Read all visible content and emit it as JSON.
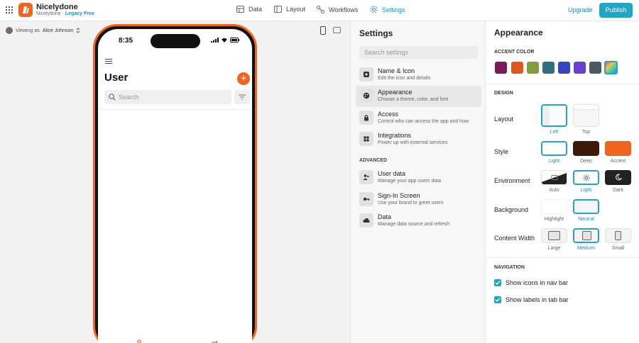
{
  "app": {
    "name": "Nicelydone",
    "org": "Nicelydone",
    "separator": "·",
    "plan": "Legacy Free"
  },
  "nav": {
    "data": "Data",
    "layout": "Layout",
    "workflows": "Workflows",
    "settings": "Settings"
  },
  "actions": {
    "upgrade": "Upgrade",
    "publish": "Publish"
  },
  "canvas": {
    "viewing_prefix": "Viewing as",
    "viewing_user": "Alice Johnson"
  },
  "phone": {
    "time": "8:35",
    "screen_title": "User",
    "add_symbol": "+",
    "search_placeholder": "Search"
  },
  "settings": {
    "title": "Settings",
    "search_placeholder": "Search settings",
    "items": [
      {
        "title": "Name & Icon",
        "desc": "Edit the icon and details",
        "icon": "app-icon"
      },
      {
        "title": "Appearance",
        "desc": "Choose a theme, color, and font",
        "icon": "palette-icon"
      },
      {
        "title": "Access",
        "desc": "Control who can access the app and how",
        "icon": "lock-icon"
      },
      {
        "title": "Integrations",
        "desc": "Power up with external services",
        "icon": "puzzle-icon"
      }
    ],
    "advanced_label": "ADVANCED",
    "advanced": [
      {
        "title": "User data",
        "desc": "Manage your app users data",
        "icon": "users-icon"
      },
      {
        "title": "Sign-In Screen",
        "desc": "Use your brand to greet users",
        "icon": "key-icon"
      },
      {
        "title": "Data",
        "desc": "Manage data source and refresh",
        "icon": "cloud-icon"
      }
    ]
  },
  "appearance": {
    "title": "Appearance",
    "accent_label": "ACCENT COLOR",
    "accent_colors": [
      "#7a1a5a",
      "#e0561f",
      "#7ea03a",
      "#2f6f80",
      "#3545c2",
      "#6a3fd0",
      "#4e5a62",
      "gradient"
    ],
    "design_label": "DESIGN",
    "layout": {
      "label": "Layout",
      "options": [
        "Left",
        "Top"
      ],
      "selected": "Left"
    },
    "style": {
      "label": "Style",
      "options": [
        "Light",
        "Deep",
        "Accent"
      ],
      "selected": "Light"
    },
    "environment": {
      "label": "Environment",
      "options": [
        "Auto",
        "Light",
        "Dark"
      ],
      "selected": "Light"
    },
    "background": {
      "label": "Background",
      "options": [
        "Highlight",
        "Neutral"
      ],
      "selected": "Neutral"
    },
    "content_width": {
      "label": "Content Width",
      "options": [
        "Large",
        "Medium",
        "Small"
      ],
      "selected": "Medium"
    },
    "navigation_label": "NAVIGATION",
    "nav_checks": [
      {
        "label": "Show icons in nav bar",
        "checked": true
      },
      {
        "label": "Show labels in tab bar",
        "checked": true
      }
    ]
  },
  "colors": {
    "accent": "#23a6c4",
    "brand": "#f0651d",
    "link": "#1a8fb5"
  }
}
